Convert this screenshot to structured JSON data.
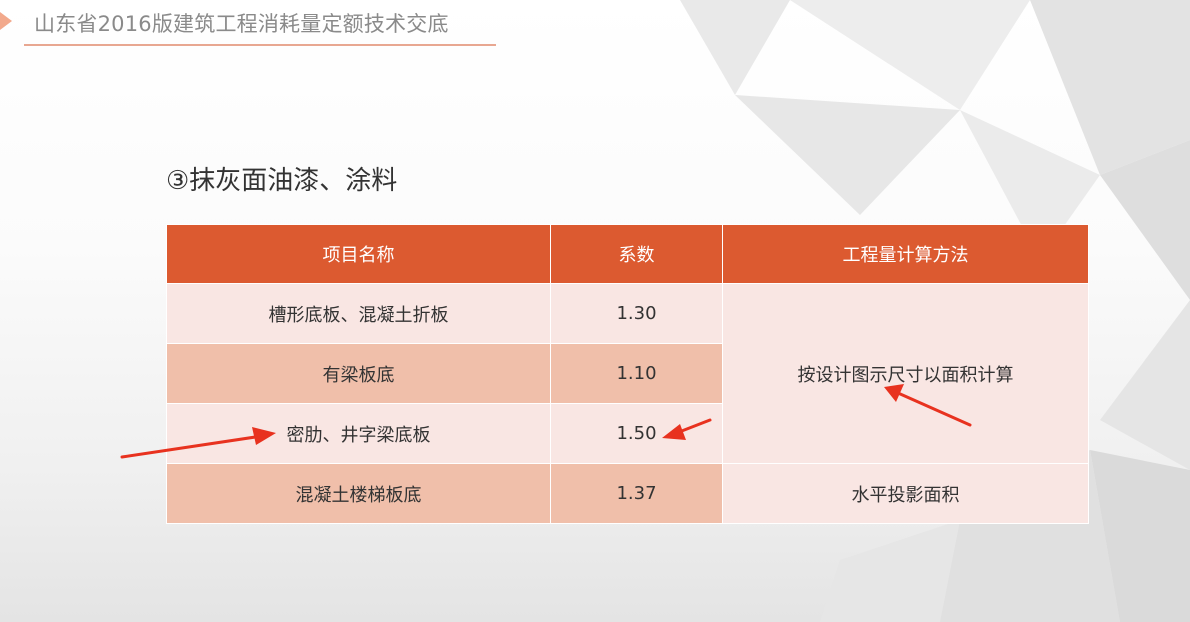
{
  "header": {
    "title": "山东省2016版建筑工程消耗量定额技术交底"
  },
  "section": {
    "title": "③抹灰面油漆、涂料"
  },
  "table": {
    "headers": [
      "项目名称",
      "系数",
      "工程量计算方法"
    ],
    "rows": [
      {
        "name": "槽形底板、混凝土折板",
        "coef": "1.30"
      },
      {
        "name": "有梁板底",
        "coef": "1.10"
      },
      {
        "name": "密肋、井字梁底板",
        "coef": "1.50"
      },
      {
        "name": "混凝土楼梯板底",
        "coef": "1.37"
      }
    ],
    "methods": {
      "merged": "按设计图示尺寸以面积计算",
      "last": "水平投影面积"
    }
  },
  "colors": {
    "header_bg": "#dc5a30",
    "row_light": "#f9e6e3",
    "row_dark": "#f0bfaa",
    "arrow": "#e8321f",
    "accent_line": "#e8a791"
  }
}
